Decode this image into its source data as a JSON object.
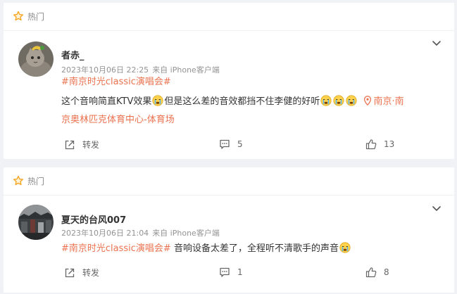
{
  "posts": [
    {
      "hot_label": "热门",
      "username": "者赤_",
      "timestamp": "2023年10月06日 22:25",
      "source": "来自 iPhone客户端",
      "tag": "#南京时光classic演唱会#",
      "text_a": "这个音响简直KTV效果",
      "text_b": "但是这么差的音效都挡不住李健的好听",
      "location_1": "南京·南",
      "location_2": "京奥林匹克体育中心-体育场",
      "share_label": "转发",
      "comments": "5",
      "likes": "13"
    },
    {
      "hot_label": "热门",
      "username": "夏天的台风007",
      "timestamp": "2023年10月06日 21:04",
      "source": "来自 iPhone客户端",
      "tag": "#南京时光classic演唱会#",
      "text_a": " 音响设备太差了，全程听不清歌手的声音",
      "share_label": "转发",
      "comments": "1",
      "likes": "8"
    }
  ],
  "icons": [
    "hot-icon",
    "chevron-down-icon",
    "share-icon",
    "comment-icon",
    "like-icon",
    "crying-emoji",
    "location-icon"
  ],
  "colors": {
    "accent": "#eb7350",
    "hot": "#f5a623",
    "text": "#333333",
    "meta": "#939393"
  }
}
